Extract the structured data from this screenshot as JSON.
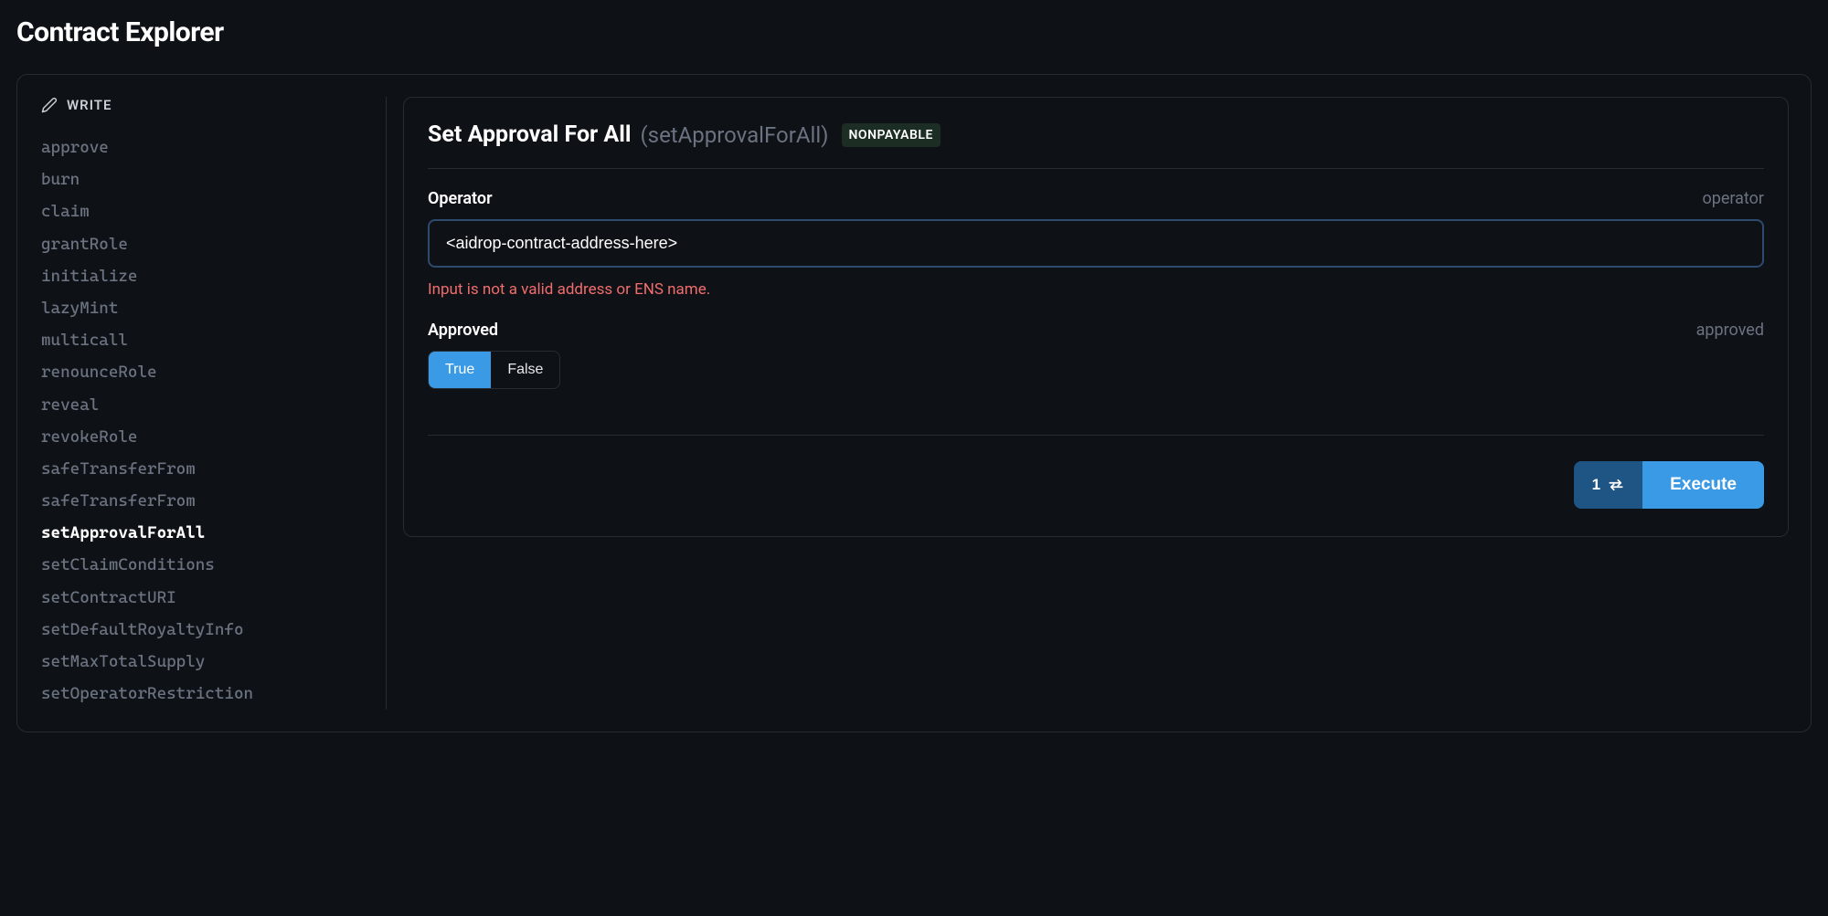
{
  "page": {
    "title": "Contract Explorer"
  },
  "sidebar": {
    "header_label": "WRITE",
    "items": [
      {
        "label": "approve",
        "active": false
      },
      {
        "label": "burn",
        "active": false
      },
      {
        "label": "claim",
        "active": false
      },
      {
        "label": "grantRole",
        "active": false
      },
      {
        "label": "initialize",
        "active": false
      },
      {
        "label": "lazyMint",
        "active": false
      },
      {
        "label": "multicall",
        "active": false
      },
      {
        "label": "renounceRole",
        "active": false
      },
      {
        "label": "reveal",
        "active": false
      },
      {
        "label": "revokeRole",
        "active": false
      },
      {
        "label": "safeTransferFrom",
        "active": false
      },
      {
        "label": "safeTransferFrom",
        "active": false
      },
      {
        "label": "setApprovalForAll",
        "active": true
      },
      {
        "label": "setClaimConditions",
        "active": false
      },
      {
        "label": "setContractURI",
        "active": false
      },
      {
        "label": "setDefaultRoyaltyInfo",
        "active": false
      },
      {
        "label": "setMaxTotalSupply",
        "active": false
      },
      {
        "label": "setOperatorRestriction",
        "active": false
      }
    ]
  },
  "function": {
    "title": "Set Approval For All",
    "signature": "(setApprovalForAll)",
    "badge": "NONPAYABLE",
    "params": {
      "operator": {
        "label": "Operator",
        "name": "operator",
        "value": "<aidrop-contract-address-here>",
        "error": "Input is not a valid address or ENS name."
      },
      "approved": {
        "label": "Approved",
        "name": "approved",
        "true_label": "True",
        "false_label": "False",
        "selected": "true"
      }
    },
    "footer": {
      "count": "1",
      "execute_label": "Execute"
    }
  }
}
